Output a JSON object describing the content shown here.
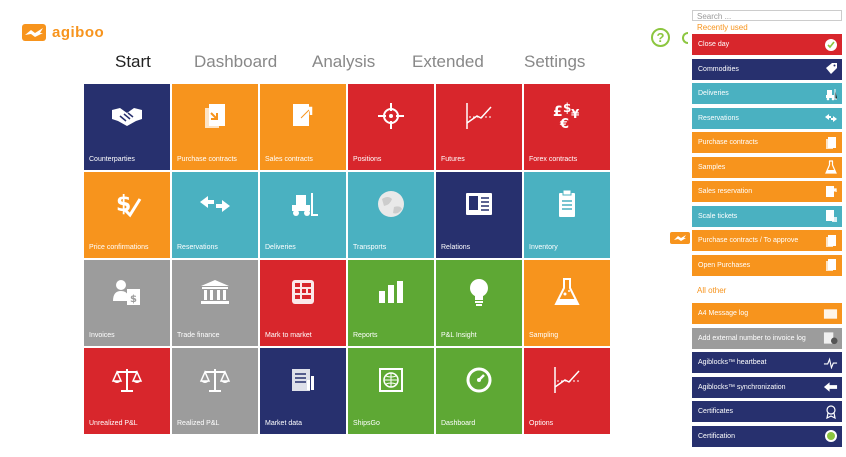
{
  "app": {
    "logo_text": "agiboo"
  },
  "tabs": [
    {
      "label": "Start",
      "active": true
    },
    {
      "label": "Dashboard",
      "active": false
    },
    {
      "label": "Analysis",
      "active": false
    },
    {
      "label": "Extended",
      "active": false
    },
    {
      "label": "Settings",
      "active": false
    }
  ],
  "help": {
    "label": "?"
  },
  "colors": {
    "brand_orange": "#f7941d",
    "navy": "#27306e",
    "red": "#d8262c",
    "teal": "#4ab1c1",
    "gray": "#9c9c9c",
    "green": "#5ea834"
  },
  "tiles": [
    {
      "label": "Counterparties",
      "icon": "handshake-icon",
      "color": "#27306e"
    },
    {
      "label": "Purchase contracts",
      "icon": "document-in-icon",
      "color": "#f7941d"
    },
    {
      "label": "Sales contracts",
      "icon": "document-out-icon",
      "color": "#f7941d"
    },
    {
      "label": "Positions",
      "icon": "crosshair-icon",
      "color": "#d8262c"
    },
    {
      "label": "Futures",
      "icon": "trend-chart-icon",
      "color": "#d8262c"
    },
    {
      "label": "Forex contracts",
      "icon": "currency-icon",
      "color": "#d8262c"
    },
    {
      "label": "Price confirmations",
      "icon": "dollar-check-icon",
      "color": "#f7941d"
    },
    {
      "label": "Reservations",
      "icon": "swap-arrows-icon",
      "color": "#4ab1c1"
    },
    {
      "label": "Deliveries",
      "icon": "forklift-icon",
      "color": "#4ab1c1"
    },
    {
      "label": "Transports",
      "icon": "globe-icon",
      "color": "#4ab1c1"
    },
    {
      "label": "Relations",
      "icon": "contact-card-icon",
      "color": "#27306e"
    },
    {
      "label": "Inventory",
      "icon": "clipboard-icon",
      "color": "#4ab1c1"
    },
    {
      "label": "Invoices",
      "icon": "invoice-person-icon",
      "color": "#9c9c9c"
    },
    {
      "label": "Trade finance",
      "icon": "bank-icon",
      "color": "#9c9c9c"
    },
    {
      "label": "Mark to market",
      "icon": "calculator-icon",
      "color": "#d8262c"
    },
    {
      "label": "Reports",
      "icon": "bar-chart-icon",
      "color": "#5ea834"
    },
    {
      "label": "P&L Insight",
      "icon": "lightbulb-icon",
      "color": "#5ea834"
    },
    {
      "label": "Sampling",
      "icon": "flask-icon",
      "color": "#f7941d"
    },
    {
      "label": "Unrealized P&L",
      "icon": "scales-icon",
      "color": "#d8262c"
    },
    {
      "label": "Realized P&L",
      "icon": "scales-icon",
      "color": "#9c9c9c"
    },
    {
      "label": "Market data",
      "icon": "market-data-icon",
      "color": "#27306e"
    },
    {
      "label": "ShipsGo",
      "icon": "globe-frame-icon",
      "color": "#5ea834"
    },
    {
      "label": "Dashboard",
      "icon": "gauge-icon",
      "color": "#5ea834"
    },
    {
      "label": "Options",
      "icon": "trend-chart-icon",
      "color": "#d8262c"
    }
  ],
  "panel": {
    "search_placeholder": "Search ...",
    "recent_title": "Recently used",
    "all_other_title": "All other",
    "recent": [
      {
        "label": "Close day",
        "color": "#d8262c",
        "icon": "check-circle-icon"
      },
      {
        "label": "Commodities",
        "color": "#27306e",
        "icon": "tag-icon"
      },
      {
        "label": "Deliveries",
        "color": "#4ab1c1",
        "icon": "forklift-icon"
      },
      {
        "label": "Reservations",
        "color": "#4ab1c1",
        "icon": "swap-arrows-icon"
      },
      {
        "label": "Purchase contracts",
        "color": "#f7941d",
        "icon": "document-in-icon"
      },
      {
        "label": "Samples",
        "color": "#f7941d",
        "icon": "flask-icon"
      },
      {
        "label": "Sales reservation",
        "color": "#f7941d",
        "icon": "document-out-icon"
      },
      {
        "label": "Scale tickets",
        "color": "#4ab1c1",
        "icon": "document-scale-icon"
      },
      {
        "label": "Purchase contracts / To approve",
        "color": "#f7941d",
        "icon": "document-in-icon"
      },
      {
        "label": "Open Purchases",
        "color": "#f7941d",
        "icon": "document-in-icon"
      }
    ],
    "all_other": [
      {
        "label": "A4 Message log",
        "color": "#f7941d",
        "icon": "message-log-icon"
      },
      {
        "label": "Add external number to invoice log",
        "color": "#9c9c9c",
        "icon": "invoice-log-icon"
      },
      {
        "label": "Agiblocks™ heartbeat",
        "color": "#27306e",
        "icon": "heartbeat-icon"
      },
      {
        "label": "Agiblocks™ synchronization",
        "color": "#27306e",
        "icon": "sync-icon"
      },
      {
        "label": "Certificates",
        "color": "#27306e",
        "icon": "award-icon"
      },
      {
        "label": "Certification",
        "color": "#27306e",
        "icon": "cert-badge-icon"
      }
    ]
  }
}
